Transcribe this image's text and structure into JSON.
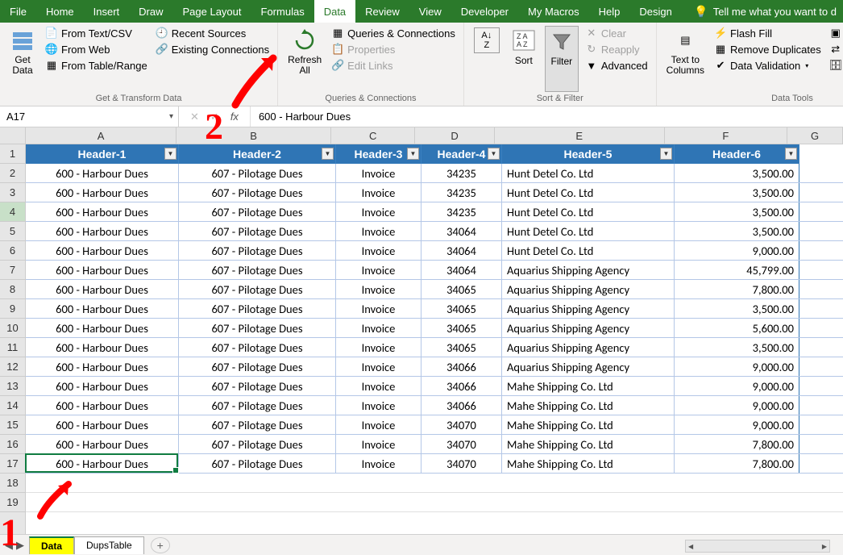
{
  "menus": [
    "File",
    "Home",
    "Insert",
    "Draw",
    "Page Layout",
    "Formulas",
    "Data",
    "Review",
    "View",
    "Developer",
    "My Macros",
    "Help",
    "Design"
  ],
  "active_menu": "Data",
  "tell_me_placeholder": "Tell me what you want to d",
  "ribbon": {
    "get_data": "Get\nData",
    "from_text_csv": "From Text/CSV",
    "from_web": "From Web",
    "from_table_range": "From Table/Range",
    "recent_sources": "Recent Sources",
    "existing_connections": "Existing Connections",
    "group1_label": "Get & Transform Data",
    "refresh_all": "Refresh\nAll",
    "queries_connections": "Queries & Connections",
    "properties": "Properties",
    "edit_links": "Edit Links",
    "group2_label": "Queries & Connections",
    "sort": "Sort",
    "filter": "Filter",
    "clear": "Clear",
    "reapply": "Reapply",
    "advanced": "Advanced",
    "group3_label": "Sort & Filter",
    "text_to_columns": "Text to\nColumns",
    "flash_fill": "Flash Fill",
    "remove_duplicates": "Remove Duplicates",
    "data_validation": "Data Validation",
    "consolidate": "Consolidate",
    "relationships": "Relationships",
    "manage_data_model": "Manage Data M",
    "group4_label": "Data Tools"
  },
  "name_box": "A17",
  "formula_bar": "600 - Harbour Dues",
  "col_letters": [
    "A",
    "B",
    "C",
    "D",
    "E",
    "F",
    "G"
  ],
  "row_numbers": [
    "1",
    "2",
    "3",
    "4",
    "5",
    "6",
    "7",
    "8",
    "9",
    "10",
    "11",
    "12",
    "13",
    "14",
    "15",
    "16",
    "17",
    "18",
    "19"
  ],
  "selected_row_header": 3,
  "cell_selection": {
    "row": 17,
    "col": 0
  },
  "headers": [
    "Header-1",
    "Header-2",
    "Header-3",
    "Header-4",
    "Header-5",
    "Header-6"
  ],
  "rows": [
    [
      "600 - Harbour Dues",
      "607 - Pilotage Dues",
      "Invoice",
      "34235",
      "Hunt Detel Co. Ltd",
      "3,500.00"
    ],
    [
      "600 - Harbour Dues",
      "607 - Pilotage Dues",
      "Invoice",
      "34235",
      "Hunt Detel Co. Ltd",
      "3,500.00"
    ],
    [
      "600 - Harbour Dues",
      "607 - Pilotage Dues",
      "Invoice",
      "34235",
      "Hunt Detel Co. Ltd",
      "3,500.00"
    ],
    [
      "600 - Harbour Dues",
      "607 - Pilotage Dues",
      "Invoice",
      "34064",
      "Hunt Detel Co. Ltd",
      "3,500.00"
    ],
    [
      "600 - Harbour Dues",
      "607 - Pilotage Dues",
      "Invoice",
      "34064",
      "Hunt Detel Co. Ltd",
      "9,000.00"
    ],
    [
      "600 - Harbour Dues",
      "607 - Pilotage Dues",
      "Invoice",
      "34064",
      "Aquarius Shipping Agency",
      "45,799.00"
    ],
    [
      "600 - Harbour Dues",
      "607 - Pilotage Dues",
      "Invoice",
      "34065",
      "Aquarius Shipping Agency",
      "7,800.00"
    ],
    [
      "600 - Harbour Dues",
      "607 - Pilotage Dues",
      "Invoice",
      "34065",
      "Aquarius Shipping Agency",
      "3,500.00"
    ],
    [
      "600 - Harbour Dues",
      "607 - Pilotage Dues",
      "Invoice",
      "34065",
      "Aquarius Shipping Agency",
      "5,600.00"
    ],
    [
      "600 - Harbour Dues",
      "607 - Pilotage Dues",
      "Invoice",
      "34065",
      "Aquarius Shipping Agency",
      "3,500.00"
    ],
    [
      "600 - Harbour Dues",
      "607 - Pilotage Dues",
      "Invoice",
      "34066",
      "Aquarius Shipping Agency",
      "9,000.00"
    ],
    [
      "600 - Harbour Dues",
      "607 - Pilotage Dues",
      "Invoice",
      "34066",
      "Mahe Shipping Co. Ltd",
      "9,000.00"
    ],
    [
      "600 - Harbour Dues",
      "607 - Pilotage Dues",
      "Invoice",
      "34066",
      "Mahe Shipping Co. Ltd",
      "9,000.00"
    ],
    [
      "600 - Harbour Dues",
      "607 - Pilotage Dues",
      "Invoice",
      "34070",
      "Mahe Shipping Co. Ltd",
      "9,000.00"
    ],
    [
      "600 - Harbour Dues",
      "607 - Pilotage Dues",
      "Invoice",
      "34070",
      "Mahe Shipping Co. Ltd",
      "7,800.00"
    ],
    [
      "600 - Harbour Dues",
      "607 - Pilotage Dues",
      "Invoice",
      "34070",
      "Mahe Shipping Co. Ltd",
      "7,800.00"
    ]
  ],
  "sheet_tabs": [
    "Data",
    "DupsTable"
  ],
  "active_tab": 0,
  "annotations": {
    "num1": "1",
    "num2": "2"
  }
}
